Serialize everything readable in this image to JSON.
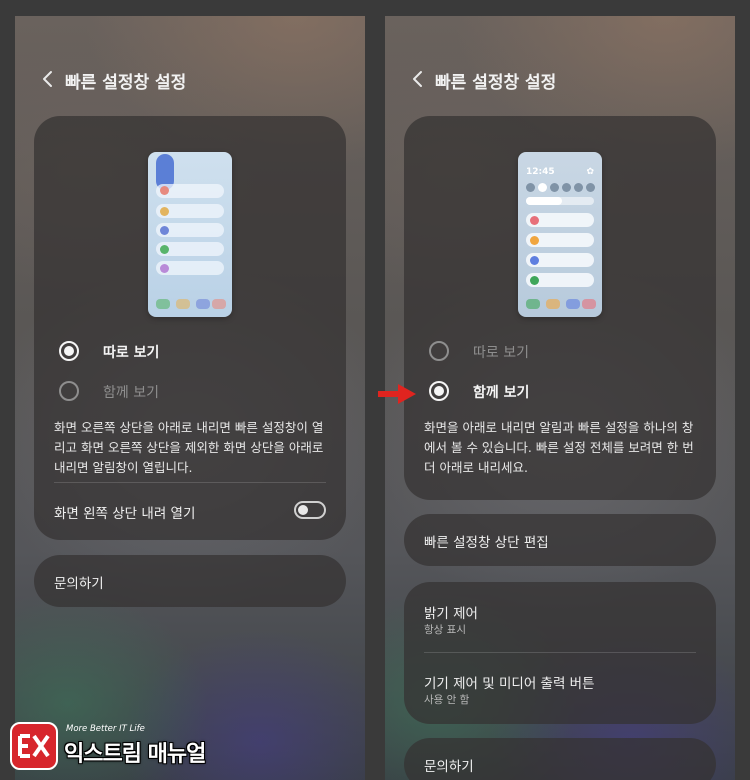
{
  "left_screen": {
    "header_title": "빠른 설정창 설정",
    "preview_colors": [
      "#e78a7f",
      "#e2b45f",
      "#6f86d8",
      "#58b46b",
      "#b98ad8"
    ],
    "options": [
      {
        "label": "따로 보기",
        "selected": true
      },
      {
        "label": "함께 보기",
        "selected": false
      }
    ],
    "description": "화면 오른쪽 상단을 아래로 내리면 빠른 설정창이 열리고 화면 오른쪽 상단을 제외한 화면 상단을 아래로 내리면 알림창이 열립니다.",
    "toggle": {
      "label": "화면 왼쪽 상단 내려 열기",
      "on": false
    },
    "contact": "문의하기"
  },
  "right_screen": {
    "header_title": "빠른 설정창 설정",
    "preview_time": "12:45",
    "preview_colors": [
      "#e7707a",
      "#f0a640",
      "#5f7fe0",
      "#3fa65a"
    ],
    "options": [
      {
        "label": "따로 보기",
        "selected": false
      },
      {
        "label": "함께 보기",
        "selected": true
      }
    ],
    "description": "화면을 아래로 내리면 알림과 빠른 설정을 하나의 창에서 볼 수 있습니다. 빠른 설정 전체를 보려면 한 번 더 아래로 내리세요.",
    "edit_top": "빠른 설정창 상단 편집",
    "items": [
      {
        "title": "밝기 제어",
        "subtitle": "항상 표시"
      },
      {
        "title": "기기 제어 및 미디어 출력 버튼",
        "subtitle": "사용 안 함"
      }
    ],
    "contact": "문의하기"
  },
  "arrow_color": "#e0241f",
  "logo": {
    "tagline": "More Better IT Life",
    "name": "익스트림 매뉴얼",
    "badge_color": "#d7262c"
  }
}
